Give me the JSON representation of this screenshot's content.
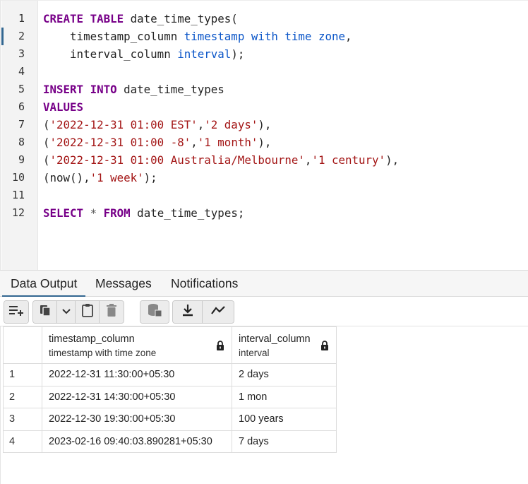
{
  "editor": {
    "line_numbers": [
      "1",
      "2",
      "3",
      "4",
      "5",
      "6",
      "7",
      "8",
      "9",
      "10",
      "11",
      "12"
    ],
    "lines": [
      [
        {
          "t": "CREATE TABLE",
          "c": "kw"
        },
        {
          "t": " date_time_types(",
          "c": "pl"
        }
      ],
      [
        {
          "t": "    timestamp_column ",
          "c": "pl"
        },
        {
          "t": "timestamp with time zone",
          "c": "ty"
        },
        {
          "t": ",",
          "c": "pl"
        }
      ],
      [
        {
          "t": "    interval_column ",
          "c": "pl"
        },
        {
          "t": "interval",
          "c": "ty"
        },
        {
          "t": ");",
          "c": "pl"
        }
      ],
      [],
      [
        {
          "t": "INSERT INTO",
          "c": "kw"
        },
        {
          "t": " date_time_types",
          "c": "pl"
        }
      ],
      [
        {
          "t": "VALUES",
          "c": "kw"
        }
      ],
      [
        {
          "t": "(",
          "c": "pl"
        },
        {
          "t": "'2022-12-31 01:00 EST'",
          "c": "str"
        },
        {
          "t": ",",
          "c": "pl"
        },
        {
          "t": "'2 days'",
          "c": "str"
        },
        {
          "t": "),",
          "c": "pl"
        }
      ],
      [
        {
          "t": "(",
          "c": "pl"
        },
        {
          "t": "'2022-12-31 01:00 -8'",
          "c": "str"
        },
        {
          "t": ",",
          "c": "pl"
        },
        {
          "t": "'1 month'",
          "c": "str"
        },
        {
          "t": "),",
          "c": "pl"
        }
      ],
      [
        {
          "t": "(",
          "c": "pl"
        },
        {
          "t": "'2022-12-31 01:00 Australia/Melbourne'",
          "c": "str"
        },
        {
          "t": ",",
          "c": "pl"
        },
        {
          "t": "'1 century'",
          "c": "str"
        },
        {
          "t": "),",
          "c": "pl"
        }
      ],
      [
        {
          "t": "(now(),",
          "c": "pl"
        },
        {
          "t": "'1 week'",
          "c": "str"
        },
        {
          "t": ");",
          "c": "pl"
        }
      ],
      [],
      [
        {
          "t": "SELECT",
          "c": "kw"
        },
        {
          "t": " * ",
          "c": "gray"
        },
        {
          "t": "FROM",
          "c": "kw"
        },
        {
          "t": " date_time_types;",
          "c": "pl"
        }
      ]
    ]
  },
  "tabs": {
    "data_output": "Data Output",
    "messages": "Messages",
    "notifications": "Notifications",
    "active": "data_output"
  },
  "toolbar": {
    "icons": [
      "add-row-icon",
      "copy-icon",
      "dropdown-chevron-icon",
      "paste-icon",
      "delete-icon",
      "save-data-icon",
      "download-icon",
      "graph-visualiser-icon"
    ]
  },
  "results": {
    "columns": [
      {
        "name": "timestamp_column",
        "type": "timestamp with time zone"
      },
      {
        "name": "interval_column",
        "type": "interval"
      }
    ],
    "rows": [
      {
        "num": "1",
        "c1": "2022-12-31 11:30:00+05:30",
        "c2": "2 days"
      },
      {
        "num": "2",
        "c1": "2022-12-31 14:30:00+05:30",
        "c2": "1 mon"
      },
      {
        "num": "3",
        "c1": "2022-12-30 19:30:00+05:30",
        "c2": "100 years"
      },
      {
        "num": "4",
        "c1": "2023-02-16 09:40:03.890281+05:30",
        "c2": "7 days"
      }
    ]
  },
  "colors": {
    "keyword": "#770088",
    "type": "#0a55c8",
    "string": "#a31515",
    "accent": "#326690"
  }
}
